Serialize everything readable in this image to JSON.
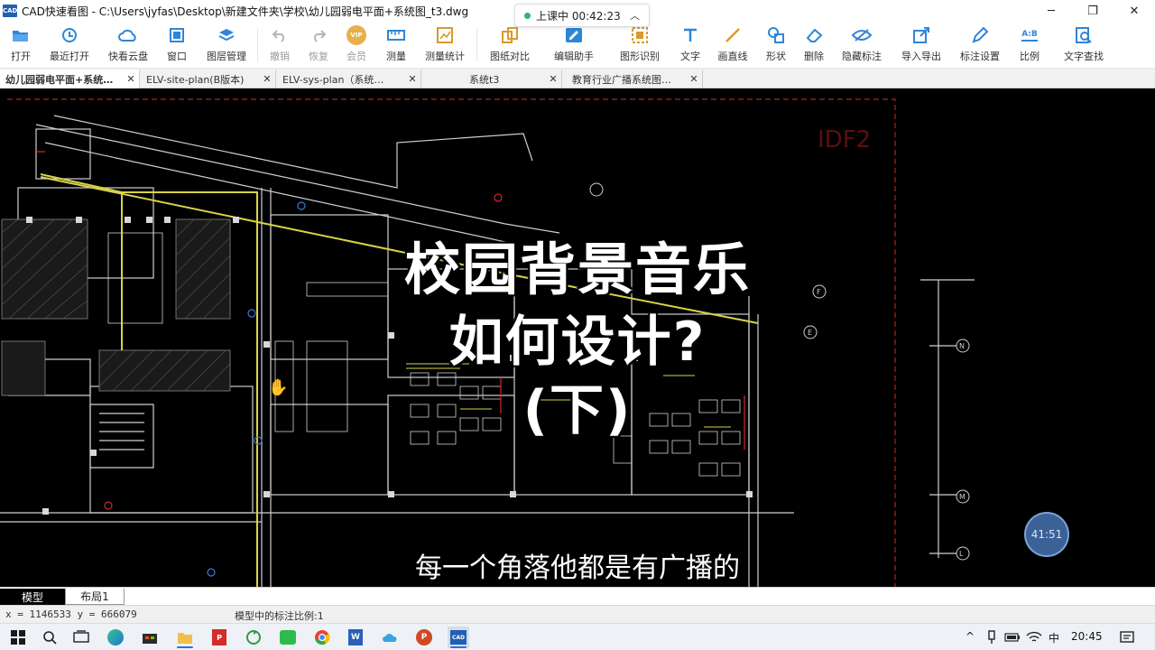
{
  "window": {
    "app_icon_text": "CAD",
    "title": "CAD快速看图 - C:\\Users\\jyfas\\Desktop\\新建文件夹\\学校\\幼儿园弱电平面+系统图_t3.dwg",
    "minimize": "─",
    "restore": "❐",
    "close": "✕"
  },
  "class_status": {
    "label": "上课中 00:42:23",
    "chevron": "︿"
  },
  "toolbar": {
    "open": "打开",
    "recent": "最近打开",
    "cloud": "快看云盘",
    "window": "窗口",
    "layers": "图层管理",
    "undo": "撤销",
    "redo": "恢复",
    "vip_badge": "VIP",
    "vip": "会员",
    "measure": "测量",
    "measure_stats": "测量统计",
    "compare": "图纸对比",
    "edit_helper": "编辑助手",
    "shape_recog": "图形识别",
    "text": "文字",
    "line": "画直线",
    "shape": "形状",
    "delete": "删除",
    "hide_mark": "隐藏标注",
    "import_export": "导入导出",
    "mark_settings": "标注设置",
    "scale_badge": "A:B",
    "scale": "比例",
    "text_search": "文字查找"
  },
  "tabs": [
    {
      "label": "幼儿园弱电平面+系统…",
      "close": "✕"
    },
    {
      "label": "ELV-site-plan(B版本)",
      "close": "✕"
    },
    {
      "label": "ELV-sys-plan（系统…",
      "close": "✕"
    },
    {
      "label": "系统t3",
      "close": "✕"
    },
    {
      "label": "教育行业广播系统图…",
      "close": "✕"
    }
  ],
  "canvas": {
    "title_line1": "校园背景音乐",
    "title_line2": "如何设计?",
    "title_line3": "(下)",
    "subtitle": "每一个角落他都是有广播的",
    "room_label": "IDF2",
    "axis_labels": [
      "N",
      "M",
      "L",
      "F",
      "E"
    ],
    "timer": "41:51"
  },
  "layout_tabs": {
    "model": "模型",
    "layout1": "布局1"
  },
  "status": {
    "coords": "x = 1146533  y = 666079",
    "scale_text": "模型中的标注比例:1"
  },
  "taskbar": {
    "ime": "中",
    "time": "20:45",
    "caret": "^"
  },
  "colors": {
    "accent": "#1f7ad8",
    "cad_background": "#000000",
    "wall_yellow": "#d8d24a",
    "idf_red": "#5a1010"
  }
}
